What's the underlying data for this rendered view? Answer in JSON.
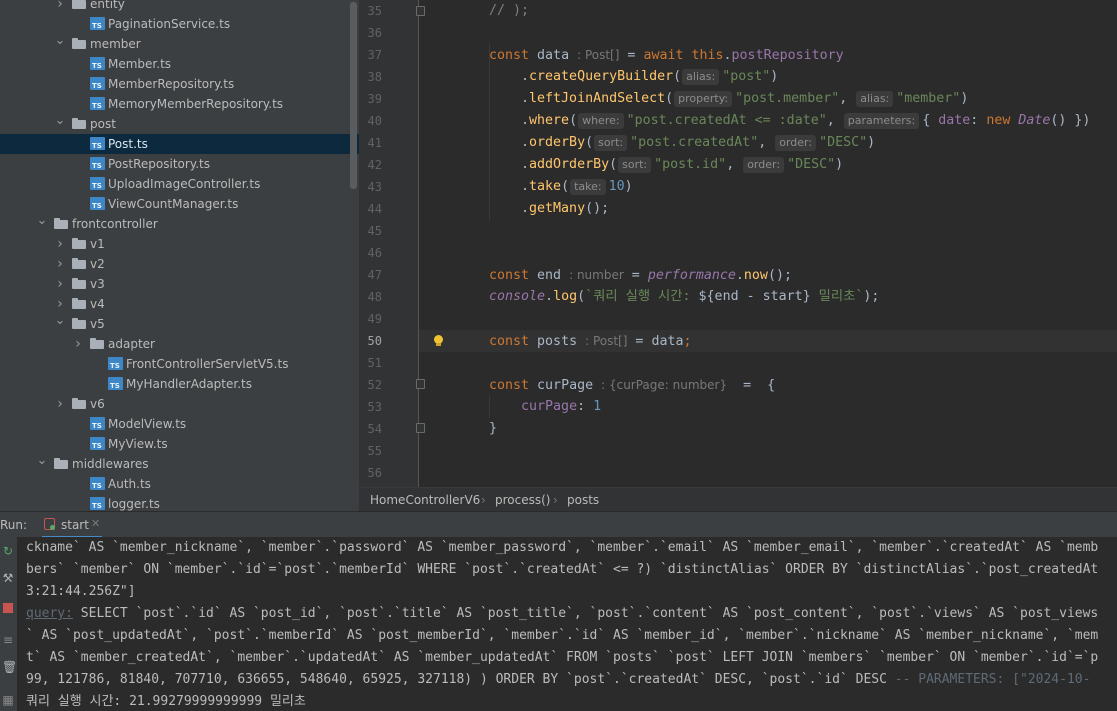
{
  "tree": {
    "rows": [
      {
        "label": "entity",
        "kind": "folder",
        "expanded": false,
        "depth": 4
      },
      {
        "label": "PaginationService.ts",
        "kind": "ts",
        "depth": 5
      },
      {
        "label": "member",
        "kind": "folder",
        "expanded": true,
        "depth": 4
      },
      {
        "label": "Member.ts",
        "kind": "ts",
        "depth": 5
      },
      {
        "label": "MemberRepository.ts",
        "kind": "ts",
        "depth": 5
      },
      {
        "label": "MemoryMemberRepository.ts",
        "kind": "ts",
        "depth": 5
      },
      {
        "label": "post",
        "kind": "folder",
        "expanded": true,
        "depth": 4
      },
      {
        "label": "Post.ts",
        "kind": "ts",
        "depth": 5,
        "selected": true
      },
      {
        "label": "PostRepository.ts",
        "kind": "ts",
        "depth": 5
      },
      {
        "label": "UploadImageController.ts",
        "kind": "ts",
        "depth": 5
      },
      {
        "label": "ViewCountManager.ts",
        "kind": "ts",
        "depth": 5
      },
      {
        "label": "frontcontroller",
        "kind": "folder",
        "expanded": true,
        "depth": 3
      },
      {
        "label": "v1",
        "kind": "folder",
        "expanded": false,
        "depth": 4
      },
      {
        "label": "v2",
        "kind": "folder",
        "expanded": false,
        "depth": 4
      },
      {
        "label": "v3",
        "kind": "folder",
        "expanded": false,
        "depth": 4
      },
      {
        "label": "v4",
        "kind": "folder",
        "expanded": false,
        "depth": 4
      },
      {
        "label": "v5",
        "kind": "folder",
        "expanded": true,
        "depth": 4
      },
      {
        "label": "adapter",
        "kind": "folder",
        "expanded": false,
        "depth": 5
      },
      {
        "label": "FrontControllerServletV5.ts",
        "kind": "ts",
        "depth": 6
      },
      {
        "label": "MyHandlerAdapter.ts",
        "kind": "ts",
        "depth": 6
      },
      {
        "label": "v6",
        "kind": "folder",
        "expanded": false,
        "depth": 4
      },
      {
        "label": "ModelView.ts",
        "kind": "ts",
        "depth": 5
      },
      {
        "label": "MyView.ts",
        "kind": "ts",
        "depth": 5
      },
      {
        "label": "middlewares",
        "kind": "folder",
        "expanded": true,
        "depth": 3
      },
      {
        "label": "Auth.ts",
        "kind": "ts",
        "depth": 5
      },
      {
        "label": "logger.ts",
        "kind": "ts",
        "depth": 5
      }
    ]
  },
  "editor": {
    "line_numbers": [
      "35",
      "36",
      "37",
      "38",
      "39",
      "40",
      "41",
      "42",
      "43",
      "44",
      "45",
      "46",
      "47",
      "48",
      "49",
      "50",
      "51",
      "52",
      "53",
      "54",
      "55",
      "56"
    ],
    "current_line": "50",
    "l35": "// );",
    "l37_kw": "const",
    "l37_var": "data",
    "l37_hint": ": Post[]",
    "l37_eq": " = ",
    "l37_await": "await",
    "l37_this": "this",
    "l37_repo": "postRepository",
    "l38_fn": "createQueryBuilder",
    "l38_hint": "alias:",
    "l38_str": "\"post\"",
    "l39_fn": "leftJoinAndSelect",
    "l39_hint1": "property:",
    "l39_str1": "\"post.member\"",
    "l39_hint2": "alias:",
    "l39_str2": "\"member\"",
    "l40_fn": "where",
    "l40_hint1": "where:",
    "l40_str": "\"post.createdAt <= :date\"",
    "l40_hint2": "parameters:",
    "l40_prop": "date",
    "l40_new": "new",
    "l40_date": "Date",
    "l41_fn": "orderBy",
    "l41_hint1": "sort:",
    "l41_str1": "\"post.createdAt\"",
    "l41_hint2": "order:",
    "l41_str2": "\"DESC\"",
    "l42_fn": "addOrderBy",
    "l42_hint1": "sort:",
    "l42_str1": "\"post.id\"",
    "l42_hint2": "order:",
    "l42_str2": "\"DESC\"",
    "l43_fn": "take",
    "l43_hint": "take:",
    "l43_num": "10",
    "l44_fn": "getMany",
    "l47_var": "end",
    "l47_hint": ": number",
    "l47_perf": "performance",
    "l47_fn": "now",
    "l48_console": "console",
    "l48_fn": "log",
    "l48_str1": "`쿼리 실행 시간: ",
    "l48_tpl": "${end - start}",
    "l48_str2": " 밀리초`",
    "l50_var": "posts",
    "l50_hint": ": Post[]",
    "l50_val": "data",
    "l52_var": "curPage",
    "l52_hint": ": {curPage: number}",
    "l53_prop": "curPage",
    "l53_num": "1",
    "l54": "}"
  },
  "breadcrumb": [
    "HomeControllerV6",
    "process()",
    "posts"
  ],
  "run": {
    "label": "Run:",
    "tab": "start",
    "lines": {
      "c1": "ckname` AS `member_nickname`, `member`.`password` AS `member_password`, `member`.`email` AS `member_email`, `member`.`createdAt` AS `memb",
      "c2": "bers` `member` ON `member`.`id`=`post`.`memberId` WHERE `post`.`createdAt` <= ?) `distinctAlias` ORDER BY `distinctAlias`.`post_createdAt",
      "c3": "3:21:44.256Z\"]",
      "c4_prefix": "query:",
      "c4": " SELECT `post`.`id` AS `post_id`, `post`.`title` AS `post_title`, `post`.`content` AS `post_content`, `post`.`views` AS `post_views",
      "c5": "` AS `post_updatedAt`, `post`.`memberId` AS `post_memberId`, `member`.`id` AS `member_id`, `member`.`nickname` AS `member_nickname`, `mem",
      "c6": "t` AS `member_createdAt`, `member`.`updatedAt` AS `member_updatedAt` FROM `posts` `post` LEFT JOIN `members` `member` ON `member`.`id`=`p",
      "c7_nums": "99, 121786, 81840, 707710, 636655, 548640, 65925, 327118) ) ORDER BY `post`.`createdAt` DESC, `post`.`id` DESC",
      "c7_params": " -- PARAMETERS: [\"2024-10-",
      "c8": "쿼리 실행 시간: 21.99279999999999 밀리초"
    }
  }
}
